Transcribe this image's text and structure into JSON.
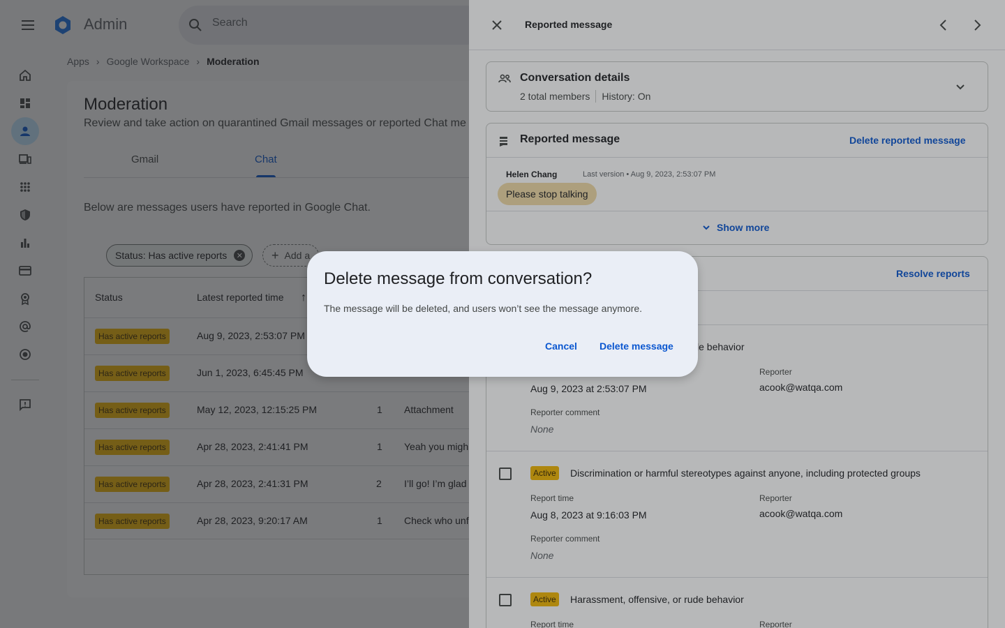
{
  "header": {
    "app_name": "Admin",
    "search_placeholder": "Search"
  },
  "breadcrumb": [
    "Apps",
    "Google Workspace",
    "Moderation"
  ],
  "page": {
    "title": "Moderation",
    "subtitle": "Review and take action on quarantined Gmail messages or reported Chat me",
    "tabs": [
      "Gmail",
      "Chat"
    ],
    "active_tab": "Chat",
    "description": "Below are messages users have reported in Google Chat.",
    "filter_chip": "Status: Has active reports",
    "add_filter": "Add a",
    "table": {
      "headers": [
        "Status",
        "Latest reported time"
      ],
      "rows": [
        {
          "status": "Has active reports",
          "time": "Aug 9, 2023, 2:53:07 PM",
          "count": "",
          "message": ""
        },
        {
          "status": "Has active reports",
          "time": "Jun 1, 2023, 6:45:45 PM",
          "count": "",
          "message": ""
        },
        {
          "status": "Has active reports",
          "time": "May 12, 2023, 12:15:25 PM",
          "count": "1",
          "message": "Attachment"
        },
        {
          "status": "Has active reports",
          "time": "Apr 28, 2023, 2:41:41 PM",
          "count": "1",
          "message": "Yeah you migh"
        },
        {
          "status": "Has active reports",
          "time": "Apr 28, 2023, 2:41:31 PM",
          "count": "2",
          "message": "I’ll go! I’m glad"
        },
        {
          "status": "Has active reports",
          "time": "Apr 28, 2023, 9:20:17 AM",
          "count": "1",
          "message": "Check who unf"
        }
      ]
    }
  },
  "panel": {
    "title": "Reported message",
    "conversation": {
      "title": "Conversation details",
      "members": "2 total members",
      "history": "History: On"
    },
    "reported": {
      "title": "Reported message",
      "delete_link": "Delete reported message",
      "sender": "Helen Chang",
      "sender_meta": "Last version • Aug 9, 2023, 2:53:07 PM",
      "message": "Please stop talking",
      "show_more": "Show more"
    },
    "resolve_link": "Resolve reports",
    "reports": [
      {
        "status": "",
        "reason": "le behavior",
        "time_label": "",
        "time": "Aug 9, 2023 at 2:53:07 PM",
        "reporter_label": "Reporter",
        "reporter": "acook@watqa.com",
        "comment_label": "Reporter comment",
        "comment": "None"
      },
      {
        "status": "Active",
        "reason": "Discrimination or harmful stereotypes against anyone, including protected groups",
        "time_label": "Report time",
        "time": "Aug 8, 2023 at 9:16:03 PM",
        "reporter_label": "Reporter",
        "reporter": "acook@watqa.com",
        "comment_label": "Reporter comment",
        "comment": "None"
      },
      {
        "status": "Active",
        "reason": "Harassment, offensive, or rude behavior",
        "time_label": "Report time",
        "reporter_label": "Reporter"
      }
    ]
  },
  "dialog": {
    "title": "Delete message from conversation?",
    "body": "The message will be deleted, and users won’t see the message anymore.",
    "cancel": "Cancel",
    "confirm": "Delete message"
  },
  "colors": {
    "accent": "#0b57d0",
    "badge": "#f2b705",
    "bubble": "#f0dba7",
    "dialog_bg": "#eaeef6"
  }
}
